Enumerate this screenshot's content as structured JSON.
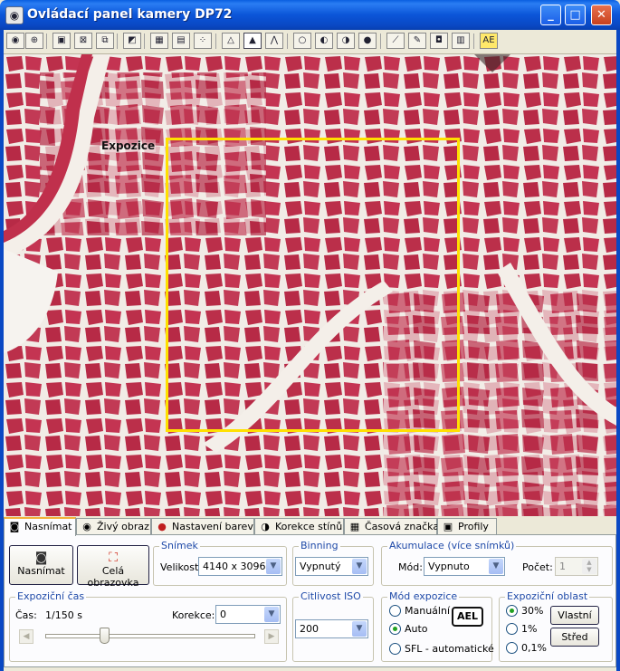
{
  "window": {
    "title": "Ovládací panel kamery DP72",
    "minimize_icon": "minimize-icon",
    "maximize_icon": "maximize-icon",
    "close_icon": "close-icon"
  },
  "toolbar": {
    "icons": [
      "eye-icon",
      "zoom-icon",
      "camera-icon",
      "fit-icon",
      "fullscreen-icon",
      "white-balance-icon",
      "color-grid-icon",
      "image-12-icon",
      "scatter-icon",
      "histogram-icon",
      "histogram-bold-icon",
      "histogram-peak-icon",
      "circle-empty-icon",
      "circle-half-icon",
      "circle-dark-icon",
      "circle-fill-icon",
      "ruler-icon",
      "pen-icon",
      "camera-small-icon",
      "save-icon",
      "ae-icon"
    ]
  },
  "viewer": {
    "exposure_label": "Expozice",
    "exposure_box_color": "#ffe000"
  },
  "tabs": [
    {
      "label": "Nasnímat",
      "icon": "camera-icon",
      "active": true
    },
    {
      "label": "Živý obraz",
      "icon": "eye-icon",
      "active": false
    },
    {
      "label": "Nastavení barev",
      "icon": "color-wheel-icon",
      "active": false
    },
    {
      "label": "Korekce stínů",
      "icon": "shading-icon",
      "active": false
    },
    {
      "label": "Časová značka",
      "icon": "calendar-icon",
      "active": false
    },
    {
      "label": "Profily",
      "icon": "disk-icon",
      "active": false
    }
  ],
  "capture": {
    "snap_label": "Nasnímat",
    "fullscreen_label": "Celá obrazovka"
  },
  "snimek": {
    "title": "Snímek",
    "size_label": "Velikost:",
    "size_value": "4140 x 3096"
  },
  "binning": {
    "title": "Binning",
    "value": "Vypnutý"
  },
  "akumulace": {
    "title": "Akumulace (více snímků)",
    "mode_label": "Mód:",
    "mode_value": "Vypnuto",
    "count_label": "Počet:",
    "count_value": "1"
  },
  "expo_cas": {
    "title": "Expoziční čas",
    "time_label": "Čas:",
    "time_value": "1/150 s",
    "correction_label": "Korekce:",
    "correction_value": "0"
  },
  "iso": {
    "title": "Citlivost ISO",
    "value": "200"
  },
  "expo_mode": {
    "title": "Mód expozice",
    "options": [
      "Manuální",
      "Auto",
      "SFL - automatické"
    ],
    "selected": "Auto",
    "ael_label": "AEL"
  },
  "expo_area": {
    "title": "Expoziční oblast",
    "options": [
      "30%",
      "1%",
      "0,1%"
    ],
    "selected": "30%",
    "custom_label": "Vlastní",
    "center_label": "Střed"
  }
}
